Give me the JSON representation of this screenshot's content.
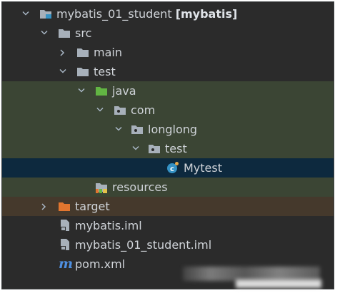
{
  "project_tree": {
    "root": {
      "name": "mybatis_01_student",
      "module": "[mybatis]"
    },
    "items": [
      {
        "label": "src"
      },
      {
        "label": "main"
      },
      {
        "label": "test"
      },
      {
        "label": "java"
      },
      {
        "label": "com"
      },
      {
        "label": "longlong"
      },
      {
        "label": "test"
      },
      {
        "label": "Mytest"
      },
      {
        "label": "resources"
      },
      {
        "label": "target"
      },
      {
        "label": "mybatis.iml"
      },
      {
        "label": "mybatis_01_student.iml"
      },
      {
        "label": "pom.xml"
      }
    ],
    "maven_glyph": "m"
  },
  "colors": {
    "panel_bg": "#2b2b2b",
    "test_source_bg": "#3b4534",
    "selected_bg": "#0d293e",
    "excluded_bg": "#45392c",
    "folder_gray": "#a7b0ba",
    "folder_green": "#62b543",
    "folder_orange": "#e2762f",
    "class_icon_blue": "#3592c4"
  },
  "icons": [
    "chevron-down-icon",
    "chevron-right-icon",
    "module-folder-icon",
    "folder-icon",
    "test-folder-icon",
    "package-icon",
    "class-icon",
    "resources-folder-icon",
    "excluded-folder-icon",
    "iml-file-icon",
    "maven-icon"
  ]
}
